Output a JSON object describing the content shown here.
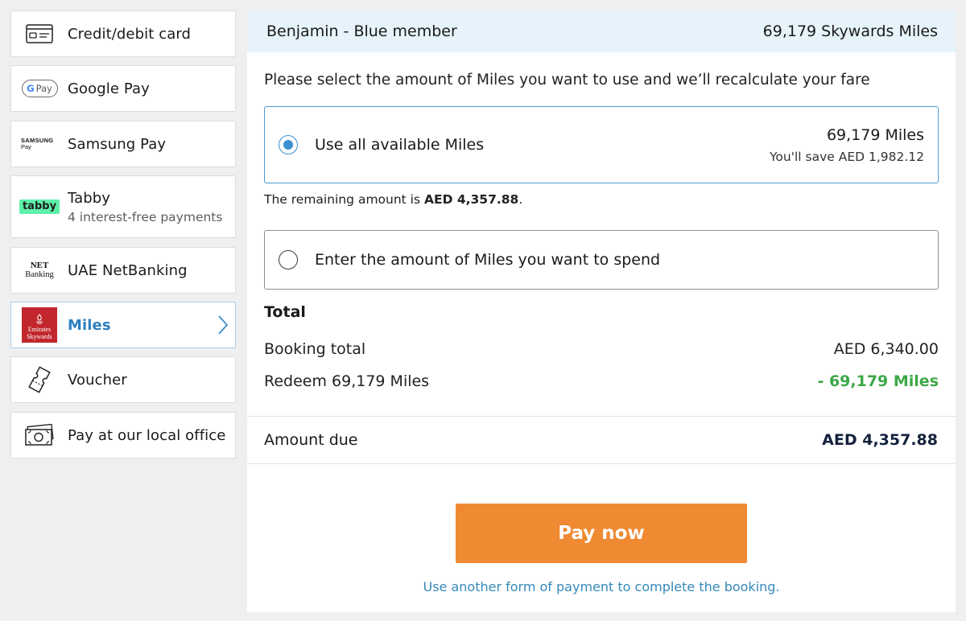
{
  "sidebar": {
    "items": [
      {
        "label": "Credit/debit card",
        "icon": "credit-card-icon"
      },
      {
        "label": "Google Pay",
        "icon": "google-pay-logo",
        "logo": {
          "g": "G",
          "rest": "Pay"
        }
      },
      {
        "label": "Samsung Pay",
        "icon": "samsung-pay-logo",
        "logo": {
          "top": "SAMSUNG",
          "bottom": "Pay"
        }
      },
      {
        "label": "Tabby",
        "sub": "4 interest-free payments",
        "icon": "tabby-logo",
        "logo": "tabby"
      },
      {
        "label": "UAE NetBanking",
        "icon": "netbanking-logo",
        "logo": {
          "top": "NET",
          "bottom": "Banking"
        }
      },
      {
        "label": "Miles",
        "icon": "emirates-skywards-logo",
        "logo": {
          "top": "Emirates",
          "bottom": "Skywards"
        },
        "active": true
      },
      {
        "label": "Voucher",
        "icon": "voucher-icon"
      },
      {
        "label": "Pay at our local office",
        "icon": "cash-icon"
      }
    ]
  },
  "header": {
    "member": "Benjamin - Blue member",
    "miles": "69,179 Skywards Miles"
  },
  "prompt": "Please select the amount of Miles you want to use and we’ll recalculate your fare",
  "options": {
    "all": {
      "label": "Use all available Miles",
      "miles": "69,179 Miles",
      "save": "You'll save AED 1,982.12",
      "selected": true
    },
    "custom": {
      "label": "Enter the amount of Miles you want to spend",
      "selected": false
    }
  },
  "remaining": {
    "prefix": "The remaining amount is ",
    "amount": "AED 4,357.88",
    "suffix": "."
  },
  "total": {
    "title": "Total",
    "booking_label": "Booking total",
    "booking_value": "AED 6,340.00",
    "redeem_label": "Redeem 69,179 Miles",
    "redeem_value": "- 69,179 Miles"
  },
  "due": {
    "label": "Amount due",
    "value": "AED 4,357.88"
  },
  "pay_button": "Pay now",
  "alt_link": "Use another form of payment to complete the booking.",
  "colors": {
    "accent": "#3a91cf",
    "pay": "#ef8a33",
    "green": "#3da747",
    "header_bg": "#e6f3fa"
  }
}
